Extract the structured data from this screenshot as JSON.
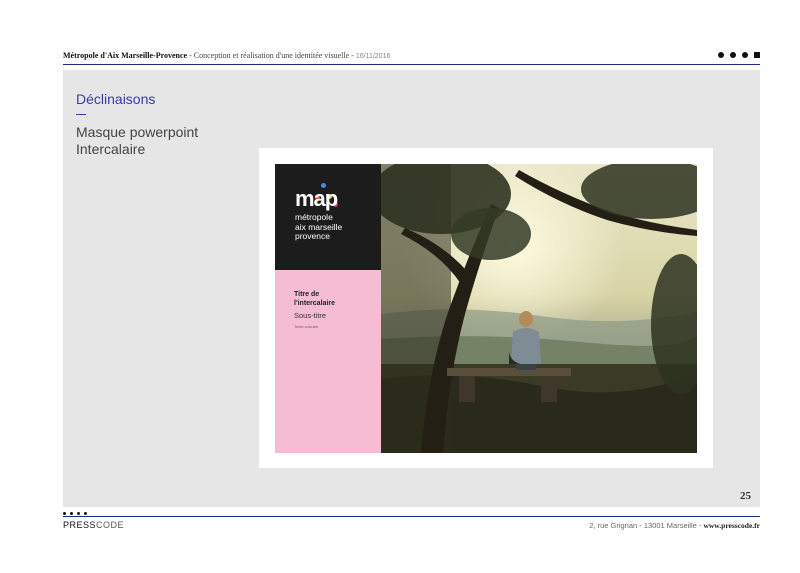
{
  "header": {
    "org": "Métropole d'Aix Marseille-Provence",
    "separator": " - ",
    "description": "Conception et réalisation d'une identitée visuelle - ",
    "date": "16/11/2016"
  },
  "panel": {
    "section_title": "Déclinaisons",
    "line1": "Masque powerpoint",
    "line2": "Intercalaire"
  },
  "slide": {
    "logo_word": "map",
    "logo_line1": "métropole",
    "logo_line2": "aix marseille",
    "logo_line3": "provence",
    "title_line1": "Titre de",
    "title_line2": "l'intercalaire",
    "subtitle": "Sous-titre",
    "body_text": "Texte courant"
  },
  "colors": {
    "accent": "#1d2b8c",
    "section_title": "#3a3aa8",
    "panel_bg": "#e6e6e6",
    "pink": "#f5bcd4",
    "logo_bg": "#1c1c1c",
    "logo_dots": [
      "#e8533a",
      "#3d8de0",
      "#f2b53d",
      "#c03c8c"
    ]
  },
  "page_number": "25",
  "footer": {
    "brand_bold": "PRESS",
    "brand_light": "CODE",
    "address": "2, rue Grignan - 13001 Marseille - ",
    "url": "www.presscode.fr"
  }
}
